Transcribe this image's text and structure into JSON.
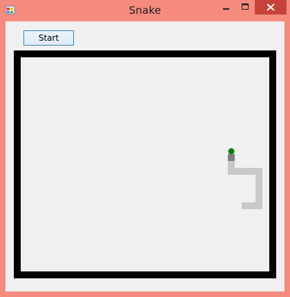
{
  "window": {
    "title": "Snake"
  },
  "controls": {
    "start_label": "Start"
  },
  "game": {
    "snake_color": "#c8c8c8",
    "head_color": "#808080",
    "food_color": "#008000",
    "border_color": "#000000"
  }
}
